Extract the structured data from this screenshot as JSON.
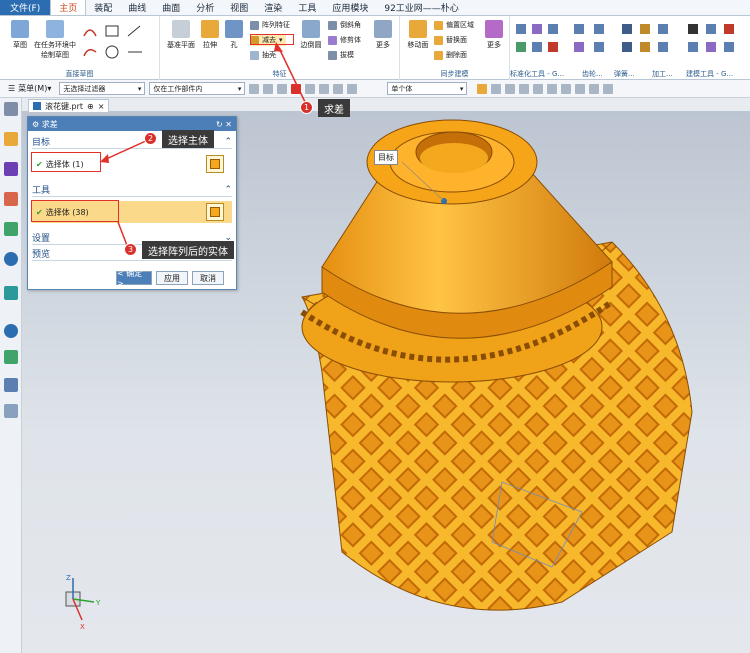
{
  "menubar": {
    "file": "文件(F)",
    "tabs": [
      "主页",
      "装配",
      "曲线",
      "曲面",
      "分析",
      "视图",
      "渲染",
      "工具",
      "应用模块",
      "92工业网——朴心"
    ]
  },
  "ribbon": {
    "sketch_group": {
      "label": "直接草图",
      "sketch": "草图",
      "task_env": "在任务环境中绘制草图"
    },
    "feature_group": {
      "label": "特征",
      "datum": "基准平面",
      "extrude": "拉伸",
      "hole": "孔",
      "pattern": "阵列特征",
      "subtract": "减去",
      "shell": "抽壳",
      "edge_blend": "边倒圆",
      "chamfer": "倒斜角",
      "trim": "修剪体",
      "draft": "拔模",
      "more": "更多"
    },
    "sync_group": {
      "label": "同步建模",
      "move_face": "移动面",
      "offset": "偏置区域",
      "replace": "替换面",
      "delete": "删除面",
      "more": "更多"
    },
    "std_tools": "标准化工具 - G...",
    "gear": "齿轮...",
    "spring": "弹簧...",
    "machining": "加工...",
    "build_tools": "建模工具 - G..."
  },
  "toolbar2": {
    "menu": "菜单(M)",
    "filter": "无选择过滤器",
    "scope": "仅在工作部件内",
    "body": "单个体"
  },
  "doc_tab": {
    "name": "滚花键.prt"
  },
  "dialog": {
    "title": "求差",
    "target_section": "目标",
    "target_select": "选择体 (1)",
    "tool_section": "工具",
    "tool_select": "选择体 (38)",
    "settings": "设置",
    "preview": "预览",
    "ok": "< 确定 >",
    "apply": "应用",
    "cancel": "取消"
  },
  "viewport": {
    "target_tag": "目标"
  },
  "annotations": [
    {
      "num": "1",
      "text": "求差"
    },
    {
      "num": "2",
      "text": "选择主体"
    },
    {
      "num": "3",
      "text": "选择阵列后的实体"
    }
  ],
  "triad": {
    "x": "X",
    "y": "Y",
    "z": "Z"
  },
  "colors": {
    "accent": "#2c6db1",
    "callout": "#d8312a",
    "part": "#f3a81e"
  }
}
